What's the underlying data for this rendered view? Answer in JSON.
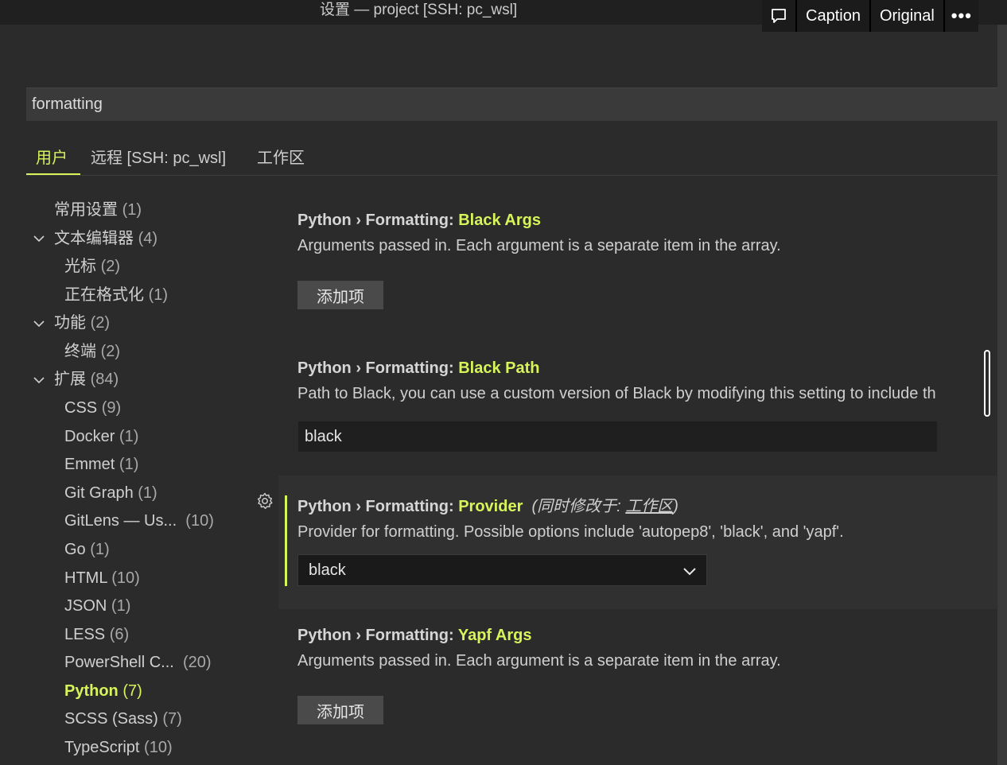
{
  "window": {
    "title": "设置 — project [SSH: pc_wsl]"
  },
  "overlay": {
    "caption_label": "Caption",
    "original_label": "Original",
    "more_label": "•••"
  },
  "search": {
    "value": "formatting"
  },
  "tabs": [
    {
      "label": "用户",
      "active": true
    },
    {
      "label": "远程 [SSH: pc_wsl]",
      "active": false
    },
    {
      "label": "工作区",
      "active": false
    }
  ],
  "toc": [
    {
      "label": "常用设置",
      "count": "(1)"
    },
    {
      "label": "文本编辑器",
      "count": "(4)",
      "expanded": true
    },
    {
      "label": "光标",
      "count": "(2)"
    },
    {
      "label": "正在格式化",
      "count": "(1)"
    },
    {
      "label": "功能",
      "count": "(2)",
      "expanded": true
    },
    {
      "label": "终端",
      "count": "(2)"
    },
    {
      "label": "扩展",
      "count": "(84)",
      "expanded": true
    },
    {
      "label": "CSS",
      "count": "(9)"
    },
    {
      "label": "Docker",
      "count": "(1)"
    },
    {
      "label": "Emmet",
      "count": "(1)"
    },
    {
      "label": "Git Graph",
      "count": "(1)"
    },
    {
      "label": "GitLens — Us...",
      "count": "(10)"
    },
    {
      "label": "Go",
      "count": "(1)"
    },
    {
      "label": "HTML",
      "count": "(10)"
    },
    {
      "label": "JSON",
      "count": "(1)"
    },
    {
      "label": "LESS",
      "count": "(6)"
    },
    {
      "label": "PowerShell C...",
      "count": "(20)"
    },
    {
      "label": "Python",
      "count": "(7)",
      "selected": true
    },
    {
      "label": "SCSS (Sass)",
      "count": "(7)"
    },
    {
      "label": "TypeScript",
      "count": "(10)"
    }
  ],
  "settings": [
    {
      "category": "Python › Formatting: ",
      "name": "Black Args",
      "description": "Arguments passed in. Each argument is a separate item in the array.",
      "button_label": "添加项"
    },
    {
      "category": "Python › Formatting: ",
      "name": "Black Path",
      "description": "Path to Black, you can use a custom version of Black by modifying this setting to include th",
      "value": "black"
    },
    {
      "category": "Python › Formatting: ",
      "name": "Provider",
      "modified_prefix": "(同时修改于: ",
      "modified_link": "工作区",
      "modified_suffix": ")",
      "description": "Provider for formatting. Possible options include 'autopep8', 'black', and 'yapf'.",
      "selected": "black"
    },
    {
      "category": "Python › Formatting: ",
      "name": "Yapf Args",
      "description": "Arguments passed in. Each argument is a separate item in the array.",
      "button_label": "添加项"
    }
  ],
  "colors": {
    "accent": "#d7f45a",
    "background": "#2b2b2b",
    "highlight_row": "#303030"
  },
  "icons": {
    "comment": "comment-icon",
    "gear": "gear-icon",
    "chevron": "chevron-down-icon",
    "more": "ellipsis-icon"
  }
}
